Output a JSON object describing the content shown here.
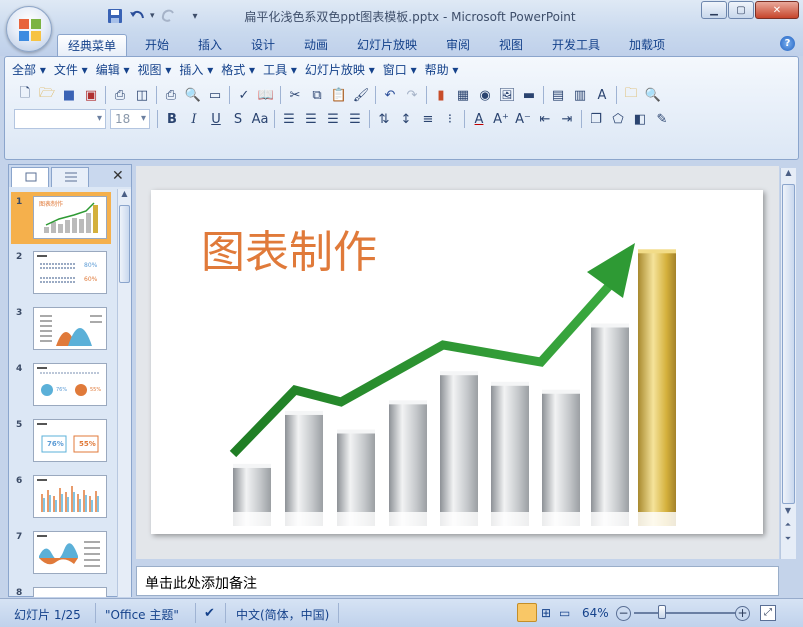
{
  "window": {
    "title": "扁平化浅色系双色ppt图表模板.pptx - Microsoft PowerPoint"
  },
  "ribbon_tabs": [
    "经典菜单",
    "开始",
    "插入",
    "设计",
    "动画",
    "幻灯片放映",
    "审阅",
    "视图",
    "开发工具",
    "加载项"
  ],
  "classic_menus": [
    "全部 ▾",
    "文件 ▾",
    "编辑 ▾",
    "视图 ▾",
    "插入 ▾",
    "格式 ▾",
    "工具 ▾",
    "幻灯片放映 ▾",
    "窗口 ▾",
    "帮助 ▾"
  ],
  "format_bar": {
    "font_name": "",
    "font_size": "18"
  },
  "slides": [
    {
      "num": "1",
      "selected": true
    },
    {
      "num": "2",
      "labels": [
        "80%",
        "60%"
      ]
    },
    {
      "num": "3"
    },
    {
      "num": "4",
      "labels": [
        "76%",
        "55%"
      ]
    },
    {
      "num": "5",
      "labels": [
        "76%",
        "55%"
      ]
    },
    {
      "num": "6"
    },
    {
      "num": "7"
    },
    {
      "num": "8"
    }
  ],
  "slide": {
    "title": "图表制作",
    "bar_levels": [
      0.17,
      0.37,
      0.3,
      0.41,
      0.52,
      0.48,
      0.45,
      0.7,
      0.98
    ]
  },
  "notes": {
    "placeholder": "单击此处添加备注"
  },
  "status": {
    "slide_info": "幻灯片 1/25",
    "theme": "\"Office 主题\"",
    "language": "中文(简体，中国)",
    "zoom": "64%"
  },
  "colors": {
    "accent": "#e07a3a",
    "arrow": "#2e9a34",
    "gold": "#d4b03c"
  }
}
